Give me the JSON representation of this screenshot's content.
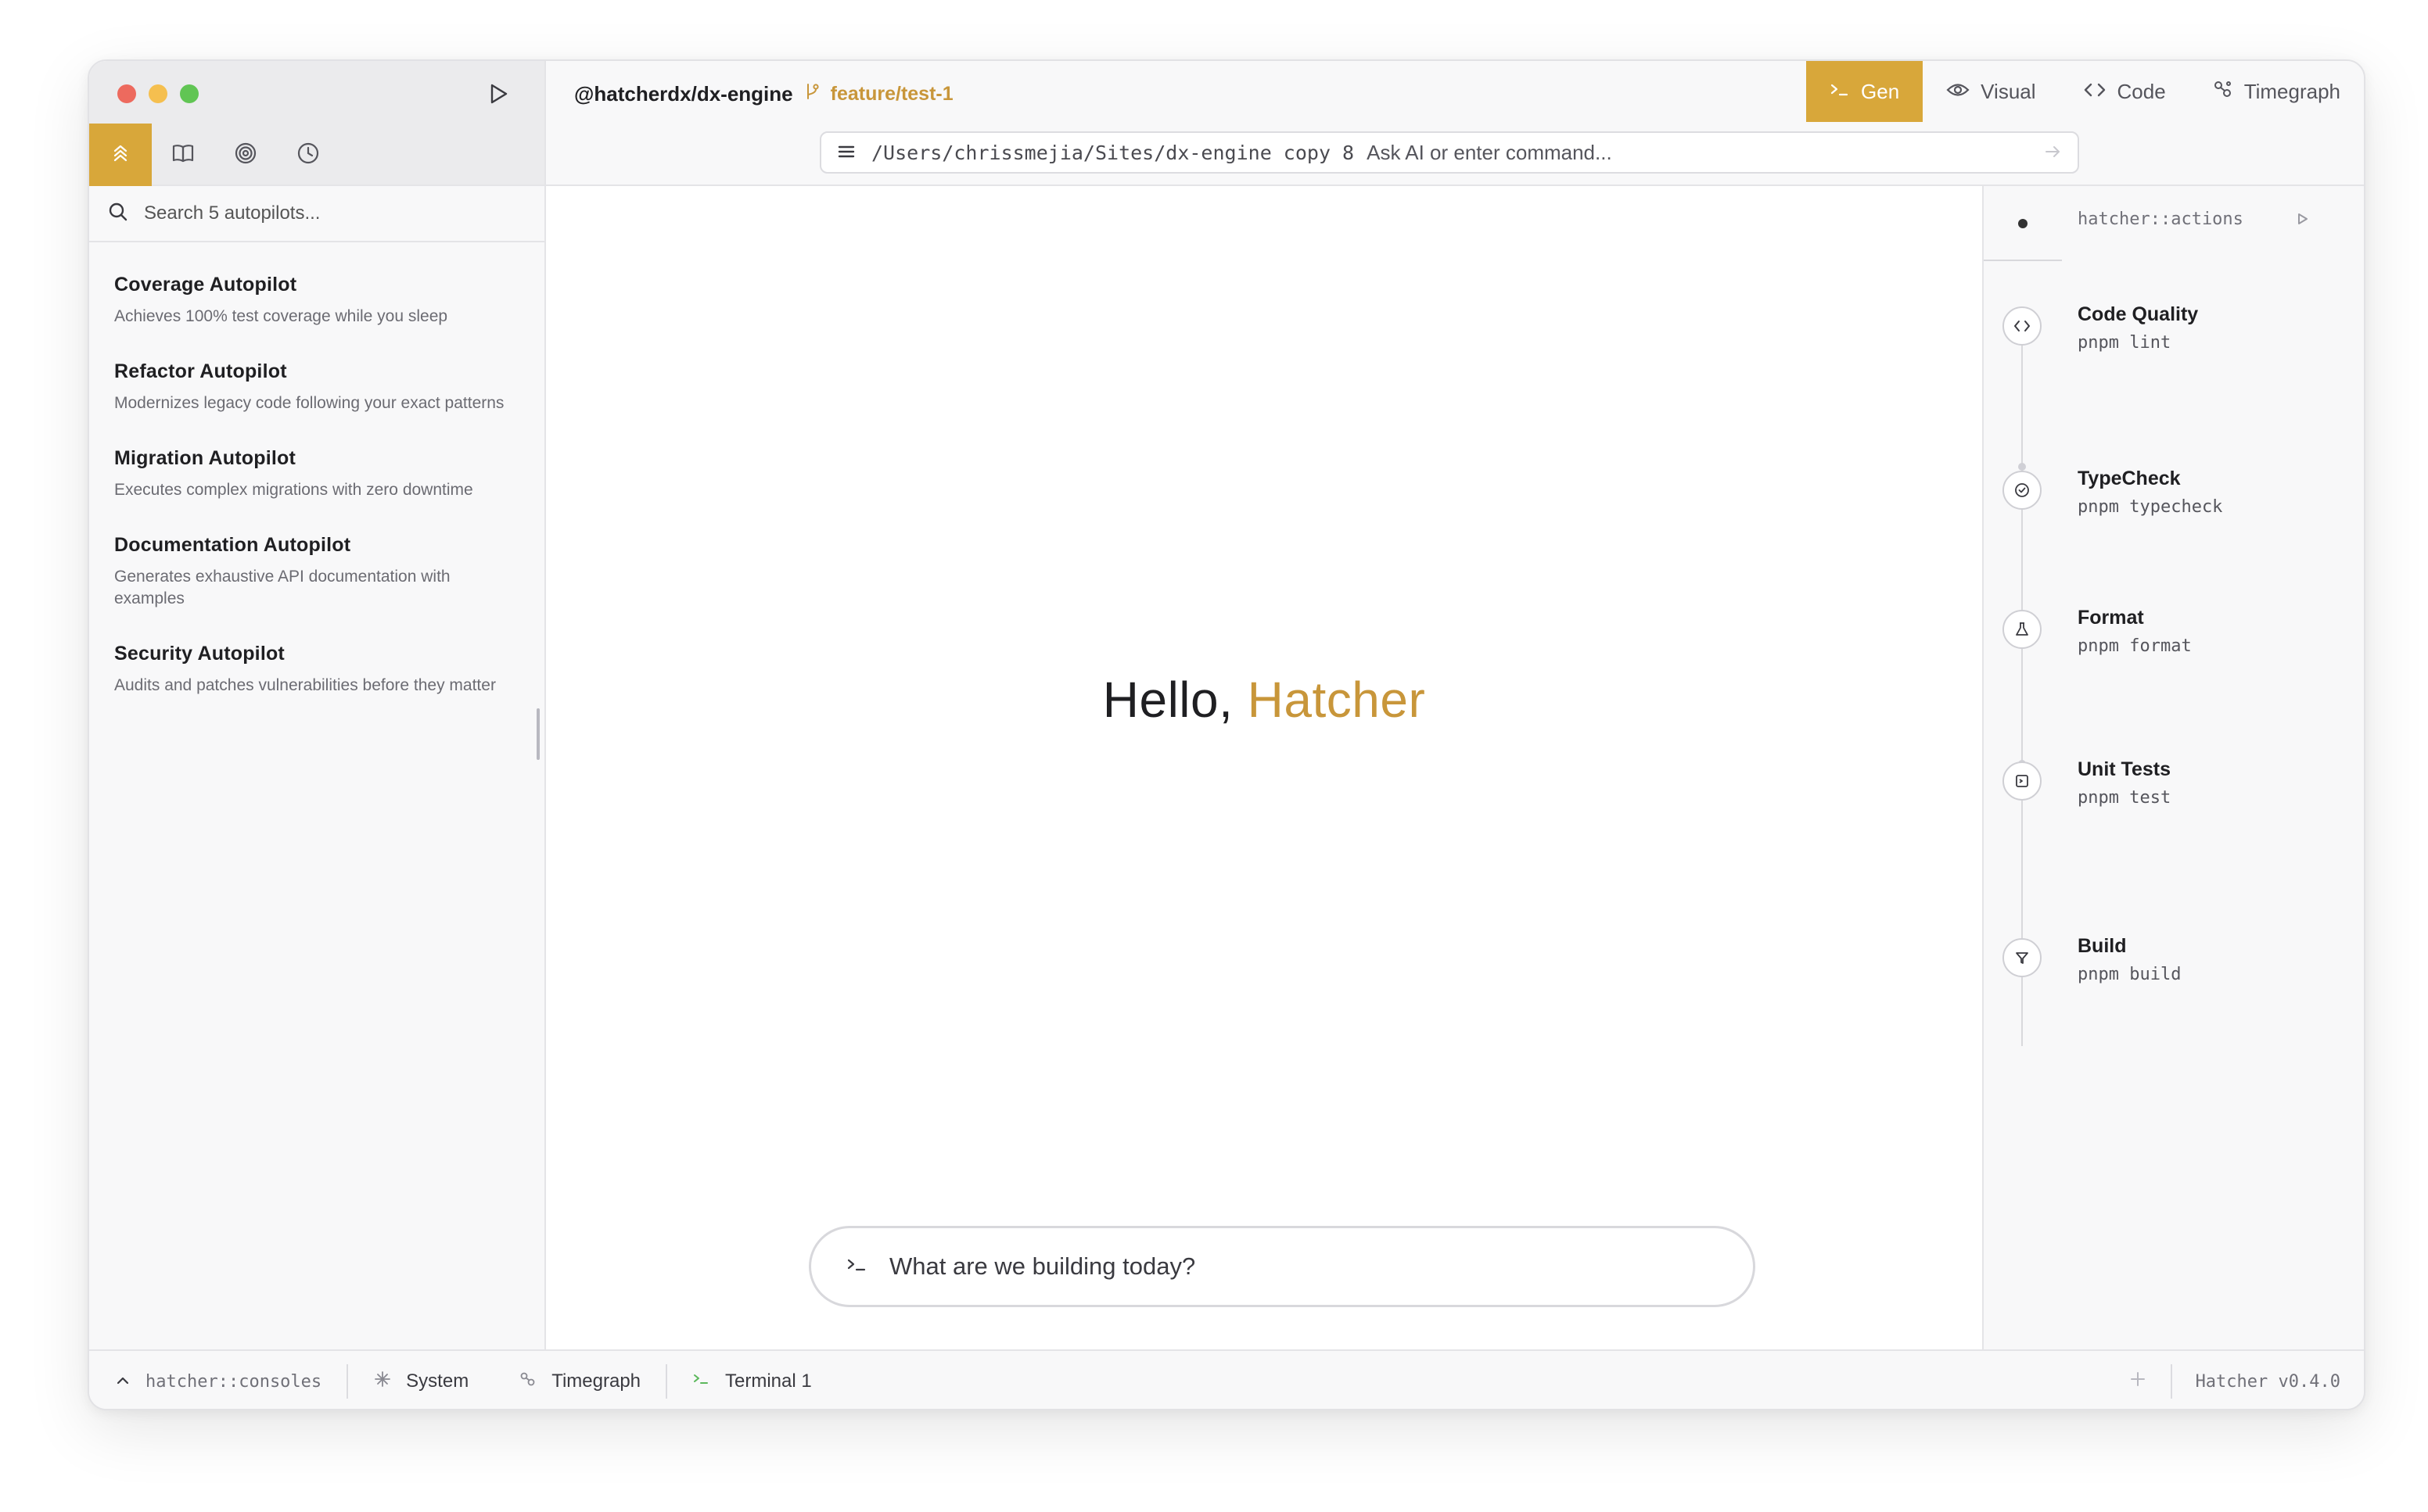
{
  "sidebar": {
    "search_placeholder": "Search 5 autopilots...",
    "tabs": [
      "autopilots-icon",
      "book-icon",
      "target-icon",
      "clock-icon"
    ],
    "autopilots": [
      {
        "title": "Coverage Autopilot",
        "description": "Achieves 100% test coverage while you sleep"
      },
      {
        "title": "Refactor Autopilot",
        "description": "Modernizes legacy code following your exact patterns"
      },
      {
        "title": "Migration Autopilot",
        "description": "Executes complex migrations with zero downtime"
      },
      {
        "title": "Documentation Autopilot",
        "description": "Generates exhaustive API documentation with examples"
      },
      {
        "title": "Security Autopilot",
        "description": "Audits and patches vulnerabilities before they matter"
      }
    ]
  },
  "header": {
    "repo": "@hatcherdx/dx-engine",
    "branch": "feature/test-1",
    "modes": [
      {
        "label": "Gen",
        "active": true
      },
      {
        "label": "Visual",
        "active": false
      },
      {
        "label": "Code",
        "active": false
      },
      {
        "label": "Timegraph",
        "active": false
      }
    ],
    "command": {
      "path": "/Users/chrissmejia/Sites/dx-engine copy 8",
      "placeholder": "Ask AI or enter command..."
    }
  },
  "main": {
    "greeting": "Hello,",
    "greeting_name": "Hatcher",
    "prompt_placeholder": "What are we building today?"
  },
  "actions_panel": {
    "title": "hatcher::actions",
    "actions": [
      {
        "name": "Code Quality",
        "command": "pnpm lint",
        "icon": "code-icon"
      },
      {
        "name": "TypeCheck",
        "command": "pnpm typecheck",
        "icon": "check-circle-icon"
      },
      {
        "name": "Format",
        "command": "pnpm format",
        "icon": "flask-icon"
      },
      {
        "name": "Unit Tests",
        "command": "pnpm test",
        "icon": "test-icon"
      },
      {
        "name": "Build",
        "command": "pnpm build",
        "icon": "funnel-icon"
      }
    ]
  },
  "console_bar": {
    "title": "hatcher::consoles",
    "tabs": [
      "System",
      "Timegraph",
      "Terminal 1"
    ],
    "version": "Hatcher v0.4.0"
  },
  "colors": {
    "accent": "#d8a73a",
    "accent_text": "#c8963a"
  }
}
